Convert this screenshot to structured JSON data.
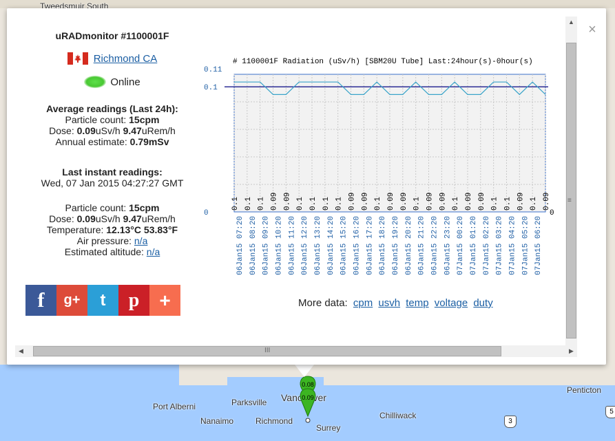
{
  "map": {
    "labels": [
      "Tweedsmuir South",
      "Port Alberni",
      "Parksville",
      "Nanaimo",
      "Richmond",
      "Vancouver",
      "Surrey",
      "Chilliwack",
      "Penticton"
    ],
    "highway_numbers": [
      "3",
      "5"
    ]
  },
  "marker": {
    "top_value": "0.08",
    "bottom_value": "0.09"
  },
  "device": {
    "title": "uRADmonitor #1100001F",
    "location": "Richmond CA",
    "status": "Online",
    "avg_heading": "Average readings (Last 24h):",
    "avg_particle_label": "Particle count: ",
    "avg_particle_value": "15cpm",
    "avg_dose_label": "Dose: ",
    "avg_dose_usv": "0.09",
    "avg_dose_usv_unit": "uSv/h ",
    "avg_dose_urem": "9.47",
    "avg_dose_urem_unit": "uRem/h",
    "annual_label": "Annual estimate: ",
    "annual_value": "0.79mSv",
    "last_heading": "Last instant readings:",
    "last_time": "Wed, 07 Jan 2015 04:27:27 GMT",
    "last_particle_label": "Particle count: ",
    "last_particle_value": "15cpm",
    "last_dose_label": "Dose: ",
    "last_dose_usv": "0.09",
    "last_dose_usv_unit": "uSv/h ",
    "last_dose_urem": "9.47",
    "last_dose_urem_unit": "uRem/h",
    "temp_label": "Temperature: ",
    "temp_c": "12.13°C",
    "temp_f": "53.83°F",
    "pressure_label": "Air pressure: ",
    "pressure_value": "n/a",
    "altitude_label": "Estimated altitude: ",
    "altitude_value": "n/a"
  },
  "social": [
    {
      "label": "f",
      "color": "#3b5998"
    },
    {
      "label": "g+",
      "color": "#dd4b39"
    },
    {
      "label": "t",
      "color": "#2b9fd7"
    },
    {
      "label": "p",
      "color": "#cb2027"
    },
    {
      "label": "+",
      "color": "#f76d4f"
    }
  ],
  "more_data": {
    "label": "More data:",
    "links": [
      "cpm",
      "usvh",
      "temp",
      "voltage",
      "duty"
    ]
  },
  "chart_data": {
    "type": "line",
    "title": "# 1100001F Radiation (uSv/h) [SBM20U Tube] Last:24hour(s)-0hour(s)",
    "y_ticks": [
      "0.11",
      "0.1",
      "0"
    ],
    "ylim": [
      0,
      0.11
    ],
    "x_end_label": "0",
    "average": 0.1,
    "categories": [
      "06Jan15 07:20",
      "06Jan15 08:20",
      "06Jan15 09:20",
      "06Jan15 10:20",
      "06Jan15 11:20",
      "06Jan15 12:20",
      "06Jan15 13:20",
      "06Jan15 14:20",
      "06Jan15 15:20",
      "06Jan15 16:20",
      "06Jan15 17:20",
      "06Jan15 18:20",
      "06Jan15 19:20",
      "06Jan15 20:20",
      "06Jan15 21:20",
      "06Jan15 22:20",
      "06Jan15 23:20",
      "07Jan15 00:20",
      "07Jan15 01:20",
      "07Jan15 02:20",
      "07Jan15 03:20",
      "07Jan15 04:20",
      "07Jan15 05:20",
      "07Jan15 06:20"
    ],
    "value_labels": [
      "0.1",
      "0.1",
      "0.1",
      "0.09",
      "0.09",
      "0.1",
      "0.1",
      "0.1",
      "0.1",
      "0.09",
      "0.09",
      "0.1",
      "0.09",
      "0.09",
      "0.1",
      "0.09",
      "0.09",
      "0.1",
      "0.09",
      "0.09",
      "0.1",
      "0.1",
      "0.09",
      "0.1",
      "0.09"
    ],
    "values": [
      0.1,
      0.1,
      0.1,
      0.09,
      0.09,
      0.1,
      0.1,
      0.1,
      0.1,
      0.09,
      0.09,
      0.1,
      0.09,
      0.09,
      0.1,
      0.09,
      0.09,
      0.1,
      0.09,
      0.09,
      0.1,
      0.1,
      0.09,
      0.1,
      0.09
    ],
    "colors": {
      "line": "#3aa4c9",
      "average": "#1a1a8c",
      "frame": "#3a6fc9",
      "labels": "#1f5fa5"
    }
  },
  "scrollbar": {
    "grip": "III"
  }
}
